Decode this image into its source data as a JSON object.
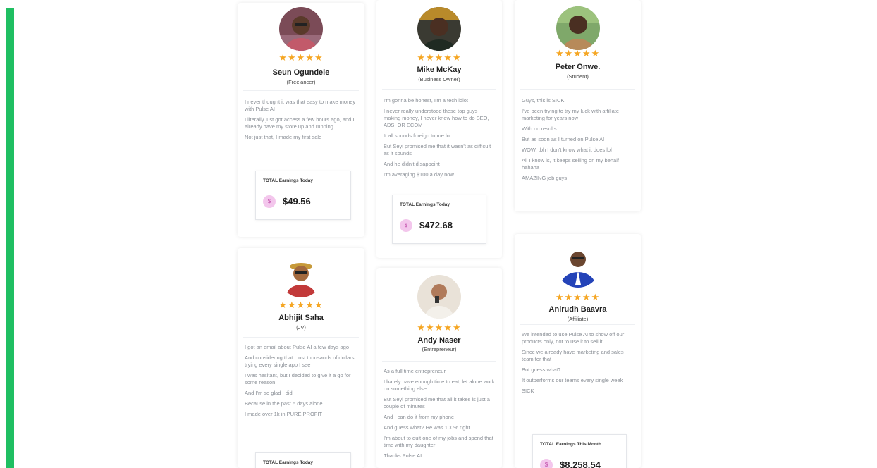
{
  "colors": {
    "accent": "#1fbf62",
    "star": "#f5a623",
    "coin": "#f3c6ec"
  },
  "testimonials": [
    {
      "name": "Seun Ogundele",
      "role": "(Freelancer)",
      "stars": "★★★★★",
      "lines": [
        "I never thought it was that easy to make money with Pulse AI",
        "I literally just got access a few hours ago, and I already have my store up and running",
        "Not just that, I made my first sale"
      ],
      "earnings_label": "TOTAL Earnings Today",
      "earnings_amount": "$49.56",
      "coin": "$"
    },
    {
      "name": "Mike McKay",
      "role": "(Business Owner)",
      "stars": "★★★★★",
      "lines": [
        "I'm gonna be honest, I'm a tech idiot",
        "I never really understood these top guys making money, I never knew how to do SEO, ADS, OR ECOM",
        "It all sounds foreign to me lol",
        "But Seyi promised me that it wasn't as difficult as it sounds",
        "And he didn't disappoint",
        "I'm averaging $100 a day now"
      ],
      "earnings_label": "TOTAL Earnings Today",
      "earnings_amount": "$472.68",
      "coin": "$"
    },
    {
      "name": "Peter Onwe.",
      "role": "(Student)",
      "stars": "★★★★★",
      "lines": [
        "Guys, this is SICK",
        "I've been trying to try my luck with affiliate marketing for years now",
        "With no results",
        "But as soon as I turned on Pulse AI",
        "WOW, tbh I don't know what it does lol",
        "All I know is, it keeps selling on my behalf hahaha",
        "AMAZING job guys"
      ]
    },
    {
      "name": "Abhijit Saha",
      "role": "(JV)",
      "stars": "★★★★★",
      "lines": [
        "I got an email about Pulse AI a few days ago",
        "And considering that I lost thousands of dollars trying every single app I see",
        "I was hesitant, but I decided to give it a go for some reason",
        "And I'm so glad I did",
        "Because in the past 5 days alone",
        "I made over 1k in PURE PROFIT"
      ],
      "earnings_label": "TOTAL Earnings Today"
    },
    {
      "name": "Andy Naser",
      "role": "(Entrepreneur)",
      "stars": "★★★★★",
      "lines": [
        "As a full time entrepreneur",
        "I barely have enough time to eat, let alone work on something else",
        "But Seyi promised me that all it takes is just a couple of minutes",
        "And I can do it from my phone",
        "And guess what? He was 100% right",
        "I'm about to quit one of my jobs and spend that time with my daughter",
        "Thanks Pulse AI"
      ]
    },
    {
      "name": "Anirudh Baavra",
      "role": "(Affiliate)",
      "stars": "★★★★★",
      "lines": [
        "We intended to use Pulse AI to show off our products only, not to use it to sell it",
        "Since we already have marketing and sales team for that",
        "But guess what?",
        "It outperforms our teams every single week",
        "SICK"
      ],
      "earnings_label": "TOTAL Earnings This Month",
      "earnings_amount": "$8,258.54",
      "coin": "$"
    }
  ]
}
